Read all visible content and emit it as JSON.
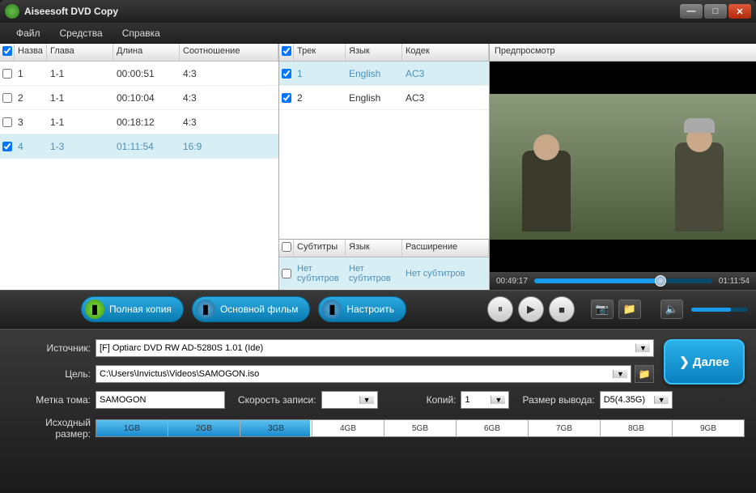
{
  "titlebar": {
    "title": "Aiseesoft DVD Copy"
  },
  "menu": {
    "file": "Файл",
    "tools": "Средства",
    "help": "Справка"
  },
  "titles": {
    "headers": {
      "name": "Назва",
      "chapter": "Глава",
      "length": "Длина",
      "ratio": "Соотношение"
    },
    "rows": [
      {
        "checked": false,
        "n": "1",
        "ch": "1-1",
        "len": "00:00:51",
        "ratio": "4:3",
        "sel": false
      },
      {
        "checked": false,
        "n": "2",
        "ch": "1-1",
        "len": "00:10:04",
        "ratio": "4:3",
        "sel": false
      },
      {
        "checked": false,
        "n": "3",
        "ch": "1-1",
        "len": "00:18:12",
        "ratio": "4:3",
        "sel": false
      },
      {
        "checked": true,
        "n": "4",
        "ch": "1-3",
        "len": "01:11:54",
        "ratio": "16:9",
        "sel": true
      }
    ]
  },
  "tracks": {
    "headers": {
      "track": "Трек",
      "lang": "Язык",
      "codec": "Кодек"
    },
    "rows": [
      {
        "checked": true,
        "n": "1",
        "lang": "English",
        "codec": "AC3",
        "sel": true
      },
      {
        "checked": true,
        "n": "2",
        "lang": "English",
        "codec": "AC3",
        "sel": false
      }
    ]
  },
  "subs": {
    "headers": {
      "sub": "Субтитры",
      "lang": "Язык",
      "ext": "Расширение"
    },
    "rows": [
      {
        "checked": false,
        "sub": "Нет субтитров",
        "lang": "Нет субтитров",
        "ext": "Нет субтитров",
        "sel": true
      }
    ]
  },
  "preview": {
    "label": "Предпросмотр",
    "cur": "00:49:17",
    "total": "01:11:54"
  },
  "modes": {
    "full": "Полная копия",
    "main": "Основной фильм",
    "custom": "Настроить"
  },
  "form": {
    "source_label": "Источник:",
    "source": "[F] Optiarc DVD RW AD-5280S 1.01 (Ide)",
    "target_label": "Цель:",
    "target": "C:\\Users\\Invictus\\Videos\\SAMOGON.iso",
    "vol_label": "Метка тома:",
    "vol": "SAMOGON",
    "speed_label": "Скорость записи:",
    "speed": "",
    "copies_label": "Копий:",
    "copies": "1",
    "outsize_label": "Размер вывода:",
    "outsize": "D5(4.35G)",
    "src_size_label": "Исходный размер:",
    "next": "Далее"
  },
  "sizes": [
    "1GB",
    "2GB",
    "3GB",
    "4GB",
    "5GB",
    "6GB",
    "7GB",
    "8GB",
    "9GB"
  ]
}
